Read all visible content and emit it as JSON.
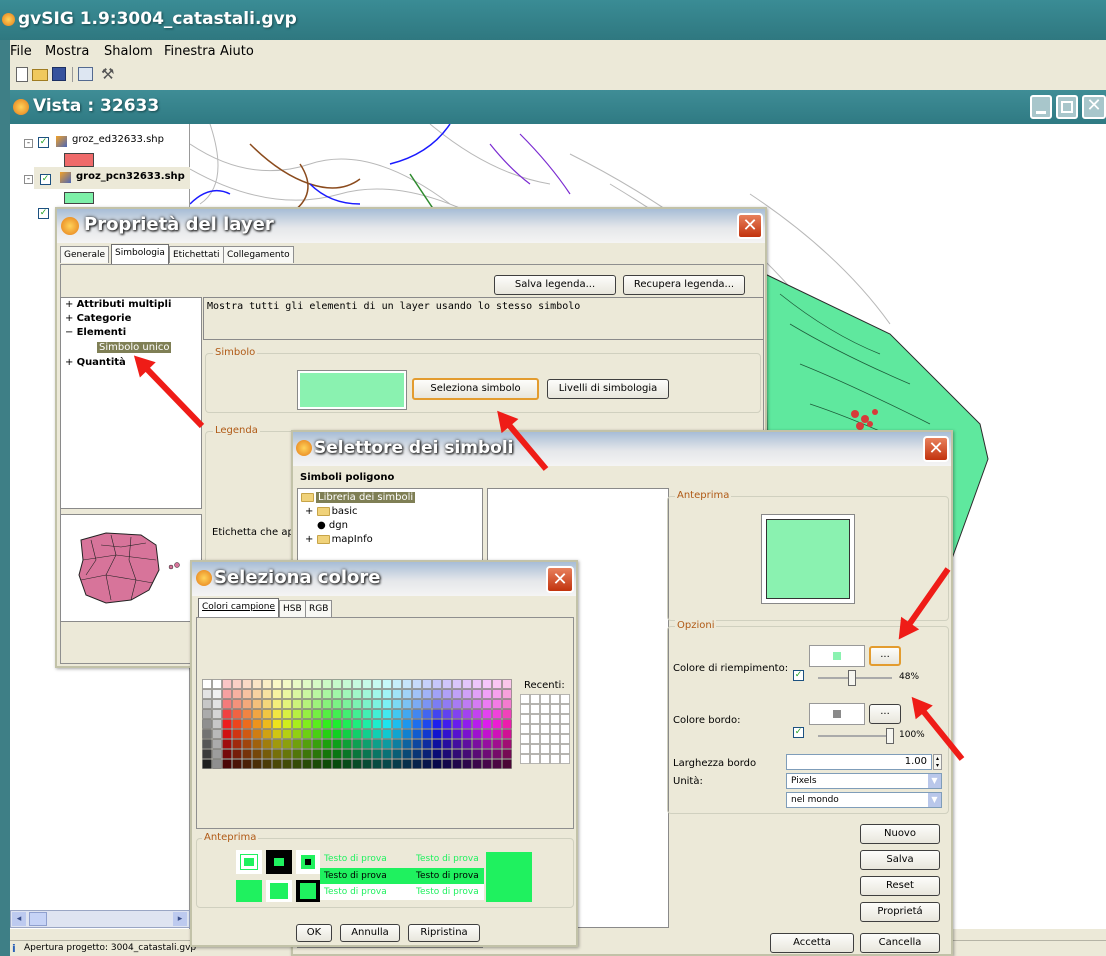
{
  "app": {
    "title": "gvSIG 1.9:3004_catastali.gvp"
  },
  "menu": [
    "File",
    "Mostra",
    "Shalom",
    "Finestra",
    "Aiuto"
  ],
  "view": {
    "title": "Vista : 32633"
  },
  "toc": {
    "layers": [
      {
        "name": "groz_ed32633.shp",
        "color": "#ef6a6a"
      },
      {
        "name": "groz_pcn32633.shp",
        "color": "#7df0a8"
      }
    ]
  },
  "status": {
    "text": "Apertura progetto: 3004_catastali.gvp"
  },
  "layer_props": {
    "title": "Proprietà del layer",
    "tabs": [
      "Generale",
      "Simbologia",
      "Etichettati",
      "Collegamento"
    ],
    "save_legend": "Salva legenda...",
    "load_legend": "Recupera legenda...",
    "tree": {
      "multi": "Attributi multipli",
      "categorie": "Categorie",
      "elementi": "Elementi",
      "simbolo_unico": "Simbolo unico",
      "quantita": "Quantità"
    },
    "description": "Mostra tutti gli elementi di un layer usando lo stesso simbolo",
    "symbol_group": "Simbolo",
    "select_symbol": "Seleziona simbolo",
    "levels": "Livelli di simbologia",
    "legend_group": "Legenda",
    "label_text": "Etichetta che appa"
  },
  "symbol_selector": {
    "title": "Selettore dei simboli",
    "subtitle": "Simboli poligono",
    "library": {
      "root": "Libreria dei simboli",
      "items": [
        "basic",
        "dgn",
        "mapInfo"
      ]
    },
    "preview": "Anteprima",
    "options": "Opzioni",
    "fill_color": "Colore di riempimento:",
    "fill_alpha": "48%",
    "border_color": "Colore bordo:",
    "border_alpha": "100%",
    "border_width_label": "Larghezza bordo",
    "border_width": "1.00",
    "units_label": "Unità:",
    "units": "Pixels",
    "ref": "nel mondo",
    "dots": "...",
    "buttons": [
      "Nuovo",
      "Salva",
      "Reset",
      "Proprietá"
    ],
    "accept": "Accetta",
    "cancel": "Cancella",
    "fill_hex": "#8af2b0"
  },
  "color_picker": {
    "title": "Seleziona colore",
    "tabs": [
      "Colori campione",
      "HSB",
      "RGB"
    ],
    "recent": "Recenti:",
    "preview": "Anteprima",
    "sample": "Testo di prova",
    "ok": "OK",
    "annulla": "Annulla",
    "ripristina": "Ripristina",
    "selected": "#1ff15f"
  }
}
